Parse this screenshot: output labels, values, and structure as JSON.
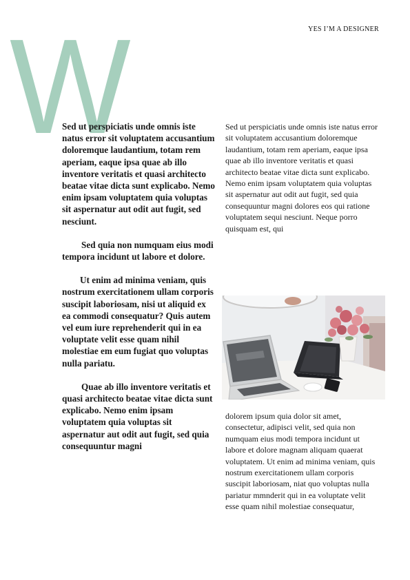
{
  "header": {
    "text": "YES I’M A DESIGNER"
  },
  "dropcap": {
    "letter": "W",
    "color": "#a6cfbd"
  },
  "left_column": {
    "p1": "Sed ut perspiciatis unde omnis iste natus error sit voluptatem accusantium doloremque laudantium, totam rem aperiam, eaque ipsa quae ab illo inventore veritatis et quasi architecto beatae vitae dicta sunt explicabo. Nemo enim ipsam voluptatem quia voluptas sit aspernatur aut odit aut fugit, sed nesciunt.",
    "p2": "Sed quia non numquam eius modi tempora incidunt ut labore et dolore.",
    "p3": "Ut enim ad minima veniam, quis nostrum exercitationem ullam corporis suscipit laboriosam, nisi ut aliquid ex ea commodi consequatur? Quis autem vel eum iure reprehenderit qui in ea voluptate velit esse quam nihil molestiae em eum fugiat quo voluptas nulla pariatu.",
    "p4": "Quae ab illo inventore veritatis et quasi architecto beatae vitae dicta sunt explicabo. Nemo enim ipsam voluptatem quia voluptas sit aspernatur aut odit aut fugit, sed quia consequuntur magni"
  },
  "right_column": {
    "top_text": "Sed ut perspiciatis unde omnis iste natus error sit voluptatem accusantium doloremque laudantium, totam rem aperiam, eaque ipsa quae ab illo inventore veritatis et quasi architecto beatae vitae dicta sunt explicabo. Nemo enim ipsam voluptatem quia voluptas sit aspernatur aut odit aut fugit, sed quia consequuntur magni dolores eos qui ratione voluptatem sequi nesciunt. Neque porro quisquam est, qui",
    "bottom_text": "dolorem ipsum quia dolor sit amet, consectetur, adipisci velit, sed quia non numquam eius modi tempora incidunt ut labore et dolore magnam aliquam quaerat voluptatem. Ut enim ad minima veniam, quis nostrum exercitationem ullam corporis suscipit laboriosam, niat quo voluptas nulla pariatur mmnderit qui in ea voluptate velit esse quam nihil molestiae consequatur,"
  }
}
